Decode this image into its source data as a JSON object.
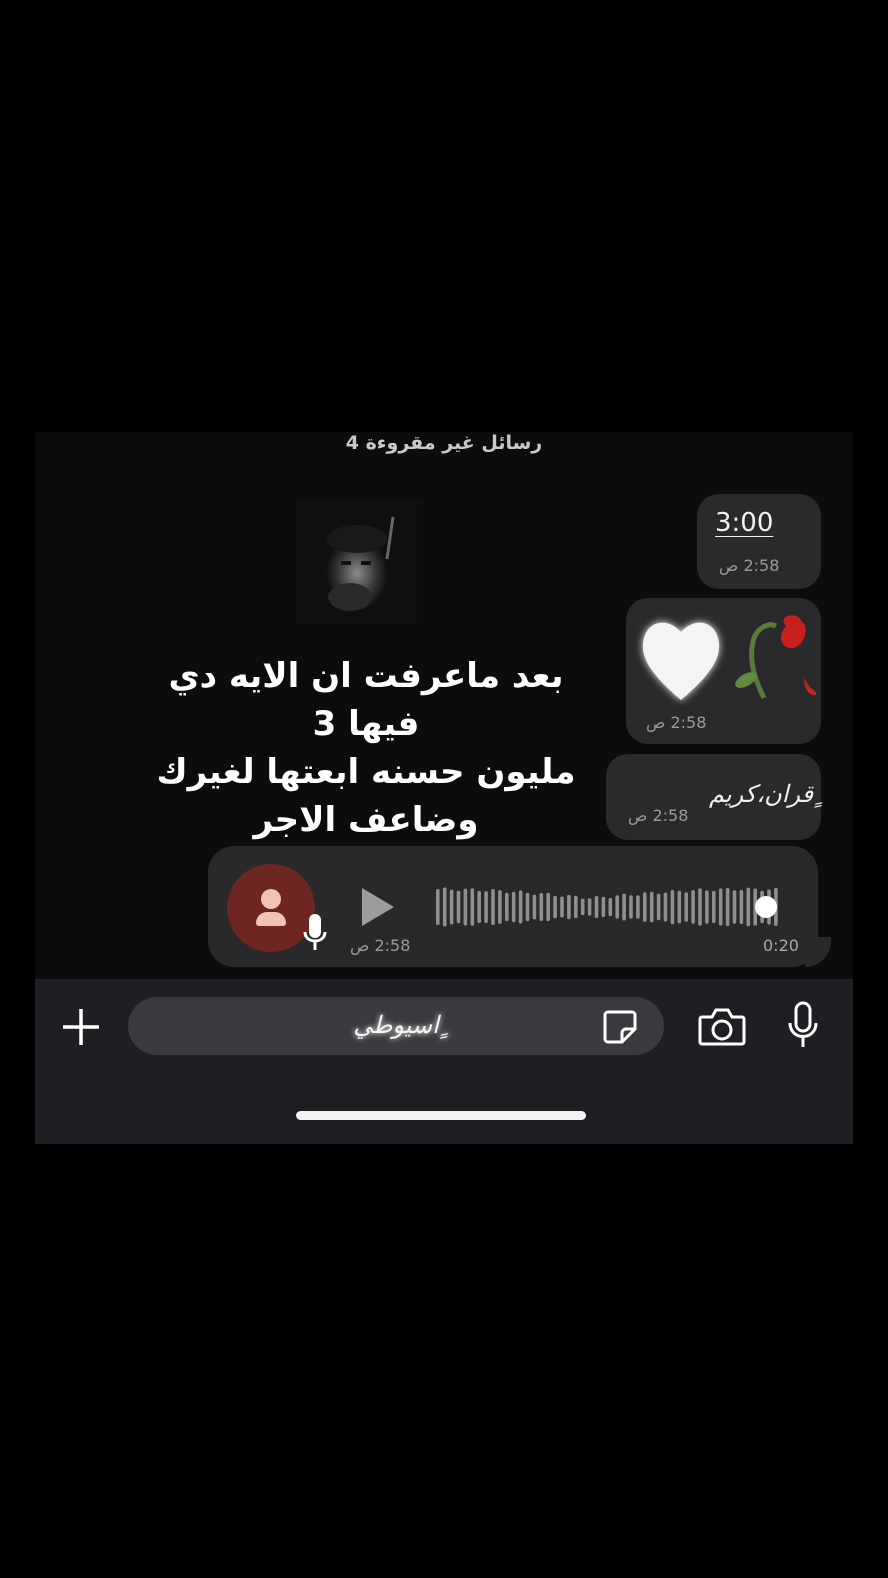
{
  "header": {
    "unread_banner": "4 رسائل غير مقروءة"
  },
  "messages": {
    "time_text": {
      "value": "3:00",
      "timestamp": "2:58 ص"
    },
    "emoji": {
      "timestamp": "2:58 ص"
    },
    "quran": {
      "text": "ٍقران،كريم",
      "timestamp": "2:58 ص"
    },
    "voice": {
      "timestamp": "2:58 ص",
      "duration": "0:20",
      "progress": 1.0
    }
  },
  "overlay": {
    "lines": [
      "بعد ماعرفت ان الايه دي فيها 3",
      "مليون حسنه ابعتها لغيرك",
      "وضاعف الاجر"
    ]
  },
  "composer": {
    "text": "ٍاسيوطي"
  },
  "icons": {
    "plus": "plus-icon",
    "sticker": "sticker-icon",
    "camera": "camera-icon",
    "mic": "microphone-icon",
    "play": "play-icon",
    "avatar": "person-icon",
    "heart": "white-heart-emoji",
    "rose": "wilted-rose-emoji"
  },
  "colors": {
    "background": "#0c0b0d",
    "bubble": "#2a292c",
    "avatar": "#6e2620",
    "bar": "#1f1e22"
  }
}
